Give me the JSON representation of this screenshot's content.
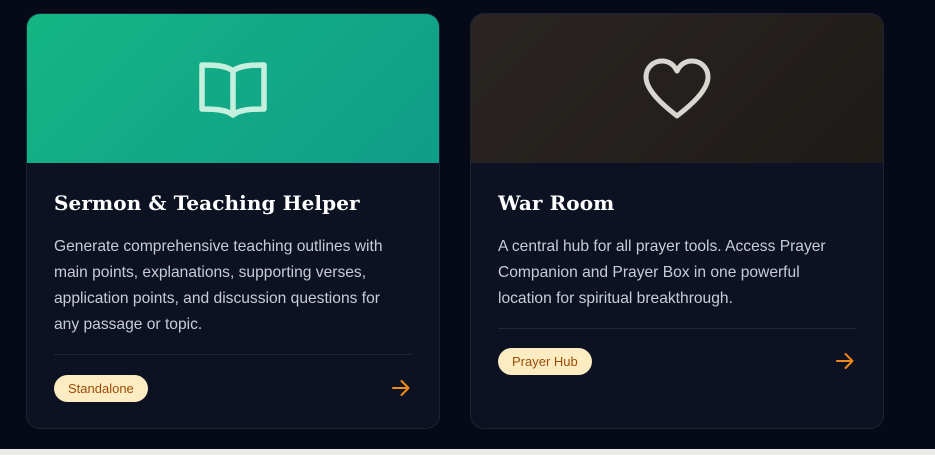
{
  "colors": {
    "page_background": "#060a17",
    "card_background": "#0d1222",
    "accent_orange": "#ef8a16",
    "badge_background": "#fdecc1",
    "badge_text": "#9b4d08",
    "green_banner": "#14b583",
    "dark_banner": "#2a2522"
  },
  "cards": [
    {
      "icon": "open-book-icon",
      "title": "Sermon & Teaching Helper",
      "description": "Generate comprehensive teaching outlines with main points, explanations, supporting verses, application points, and discussion questions for any passage or topic.",
      "badge": "Standalone",
      "action_icon": "arrow-right-icon"
    },
    {
      "icon": "heart-icon",
      "title": "War Room",
      "description": "A central hub for all prayer tools. Access Prayer Companion and Prayer Box in one powerful location for spiritual breakthrough.",
      "badge": "Prayer Hub",
      "action_icon": "arrow-right-icon"
    }
  ]
}
